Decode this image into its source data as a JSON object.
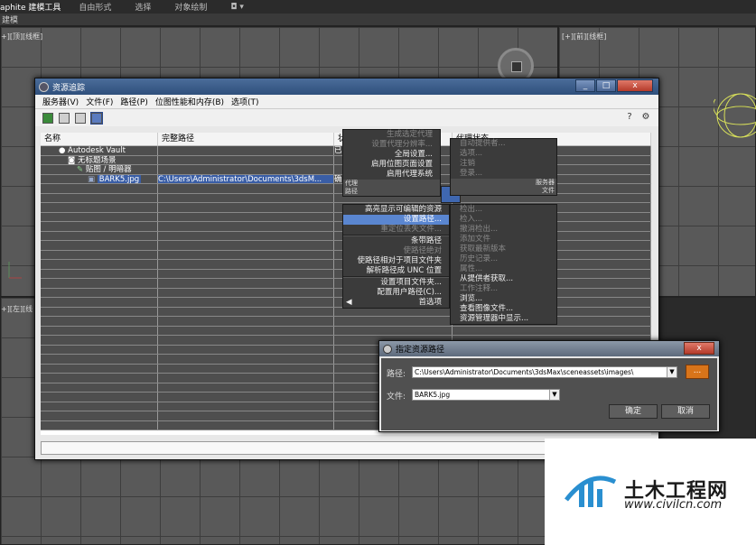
{
  "ribbon": {
    "items": [
      "aphite 建模工具",
      "自由形式",
      "选择",
      "对象绘制",
      "◘ ▾"
    ]
  },
  "subbar": {
    "label": "建模"
  },
  "viewports": {
    "top_left": "+][顶][线框]",
    "top_right": "[+][前][线框]",
    "bottom_left": "+][左][线"
  },
  "asset_window": {
    "title": "资源追踪",
    "minimize": "_",
    "maximize": "□",
    "close": "x",
    "menus": [
      "服务器(V)",
      "文件(F)",
      "路径(P)",
      "位图性能和内存(B)",
      "选项(T)"
    ],
    "toolbar_right": [
      "?",
      "⚙"
    ],
    "columns": [
      "名称",
      "完整路径",
      "状",
      "代理状态"
    ],
    "rows": [
      {
        "name": "Autodesk Vault",
        "path": "",
        "status": "已",
        "proxy": ""
      },
      {
        "name": "无标题场景",
        "path": "",
        "status": "",
        "proxy": ""
      },
      {
        "name": "贴图 / 明暗器",
        "path": "",
        "status": "",
        "proxy": ""
      },
      {
        "name": "BARK5.jpg",
        "path": "C:\\Users\\Administrator\\Documents\\3dsM...",
        "status": "确",
        "proxy": ""
      }
    ]
  },
  "quad_menu": {
    "left_top": [
      "生成选定代理",
      "设置代理分辨率...",
      "全局设置...",
      "启用位图页面设置",
      "启用代理系统"
    ],
    "left_header_l": "代理",
    "left_header_l2": "路径",
    "right_header_r": "服务器",
    "right_header_r2": "文件",
    "right_top": [
      "自动提供者...",
      "选项...",
      "注销",
      "登录..."
    ],
    "left_bottom": [
      "高亮显示可编辑的资源",
      "设置路径...",
      "重定位丢失文件...",
      "条带路径",
      "使路径绝对",
      "使路径相对于项目文件夹",
      "解析路径成 UNC 位置",
      "设置项目文件夹...",
      "配置用户路径(C)...",
      "首选项"
    ],
    "left_bottom_arrow": "◀",
    "right_bottom": [
      "检出...",
      "检入...",
      "撤消检出...",
      "添加文件",
      "获取最新版本",
      "历史记录...",
      "属性...",
      "从提供者获取...",
      "工作注释...",
      "浏览...",
      "查看图像文件...",
      "资源管理器中显示..."
    ]
  },
  "path_dialog": {
    "title": "指定资源路径",
    "close": "x",
    "path_label": "路径:",
    "path_value": "C:\\Users\\Administrator\\Documents\\3dsMax\\sceneassets\\images\\",
    "browse": "...",
    "file_label": "文件:",
    "file_value": "BARK5.jpg",
    "ok": "确定",
    "cancel": "取消"
  },
  "logo": {
    "name": "土木工程网",
    "url": "www.civilcn.com"
  }
}
